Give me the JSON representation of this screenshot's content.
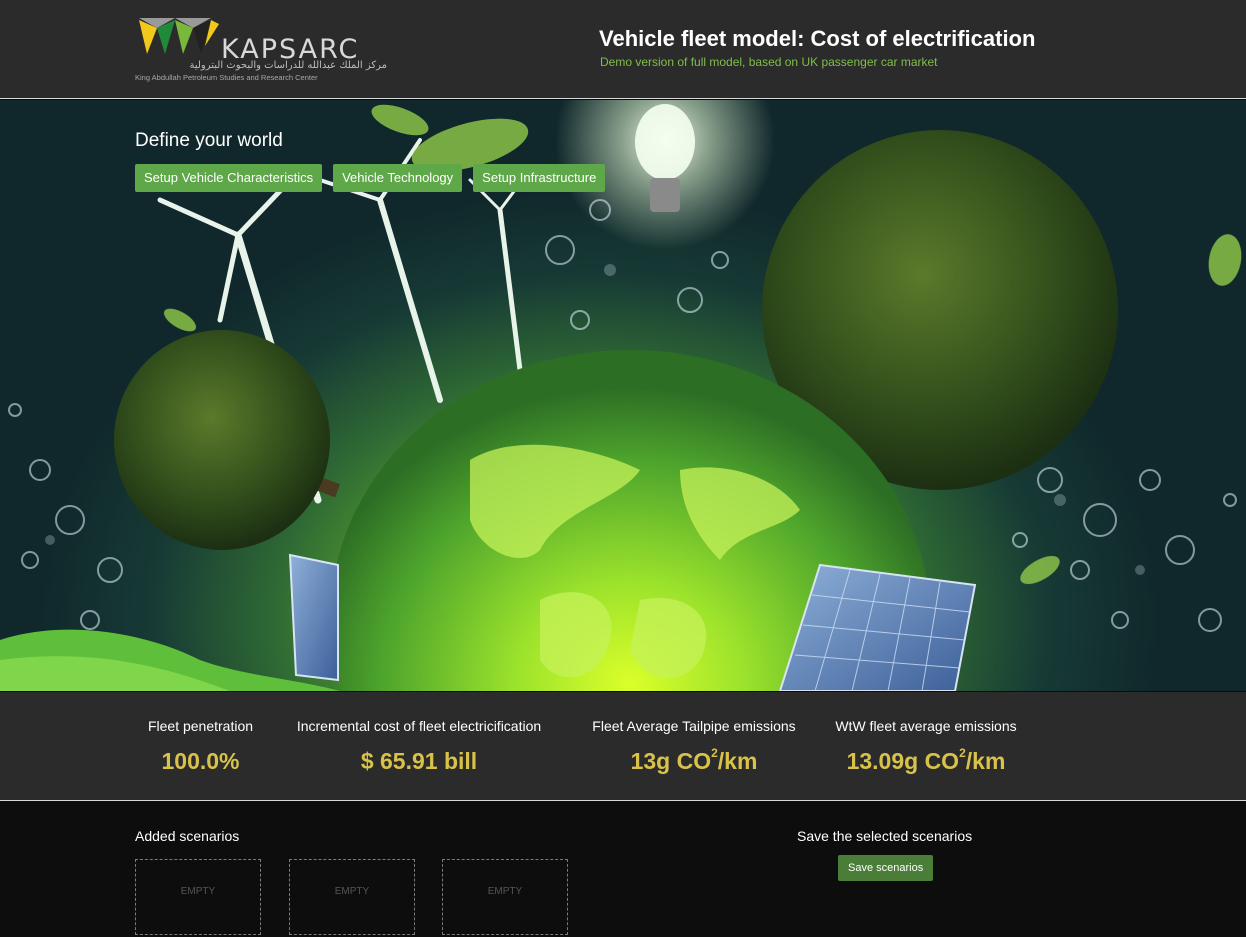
{
  "header": {
    "logo_word": "KAPSARC",
    "logo_arabic": "مركز الملك عبدالله للدراسات والبحوث البترولية",
    "logo_subtitle": "King Abdullah Petroleum Studies and Research Center",
    "title": "Vehicle fleet model: Cost of electrification",
    "subtitle": "Demo version of full model, based on UK passenger car market"
  },
  "hero": {
    "heading": "Define your world",
    "buttons": [
      {
        "label": "Setup Vehicle Characteristics"
      },
      {
        "label": "Vehicle Technology"
      },
      {
        "label": "Setup Infrastructure"
      }
    ]
  },
  "metrics": [
    {
      "label": "Fleet penetration",
      "value": "100.0%"
    },
    {
      "label": "Incremental cost of fleet electricification",
      "value": "$ 65.91 bill"
    },
    {
      "label": "Fleet Average Tailpipe emissions",
      "value_main": "13g CO",
      "value_sup": "2",
      "value_unit": "/km"
    },
    {
      "label": "WtW fleet average emissions",
      "value_main": "13.09g CO",
      "value_sup": "2",
      "value_unit": "/km"
    }
  ],
  "scenarios": {
    "title": "Added scenarios",
    "slots": [
      {
        "label": "EMPTY"
      },
      {
        "label": "EMPTY"
      },
      {
        "label": "EMPTY"
      }
    ],
    "save_title": "Save the selected scenarios",
    "save_button": "Save scenarios"
  },
  "colors": {
    "header_bg": "#2b2b2b",
    "accent_green": "#5fa84a",
    "subtitle_green": "#7fbf4a",
    "metric_gold": "#d9c24a",
    "page_bg": "#0d0d0d"
  },
  "icons": {
    "logo": "kapsarc-logo-icon"
  }
}
